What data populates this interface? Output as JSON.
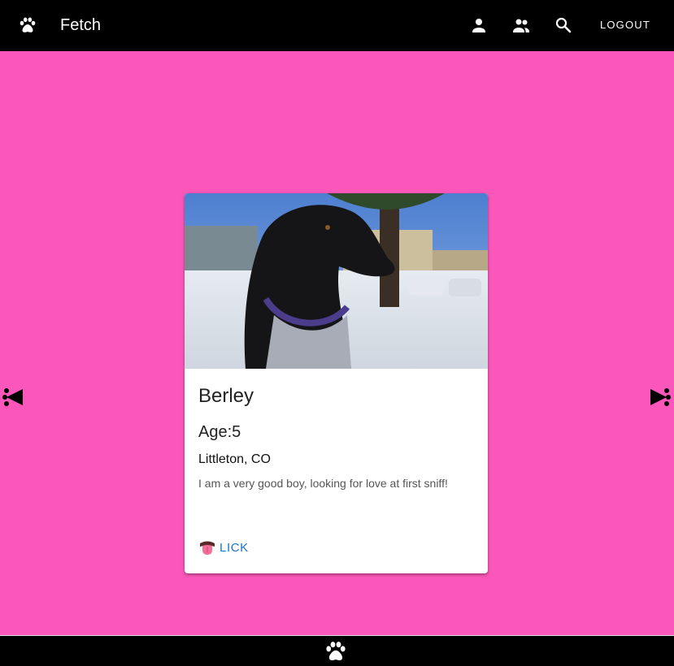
{
  "app": {
    "title": "Fetch"
  },
  "nav": {
    "icons": [
      "paw-icon",
      "person-icon",
      "people-icon",
      "search-icon"
    ],
    "logout_label": "LOGOUT"
  },
  "profile": {
    "name": "Berley",
    "age": "Age:5",
    "location": "Littleton, CO",
    "bio": "I am a very good boy, looking for love at first sniff!",
    "action_label": "LICK",
    "photo_alt": "dog-photo"
  },
  "colors": {
    "background": "#fb57ba",
    "appbar": "#000000",
    "accent": "#1976d2"
  }
}
